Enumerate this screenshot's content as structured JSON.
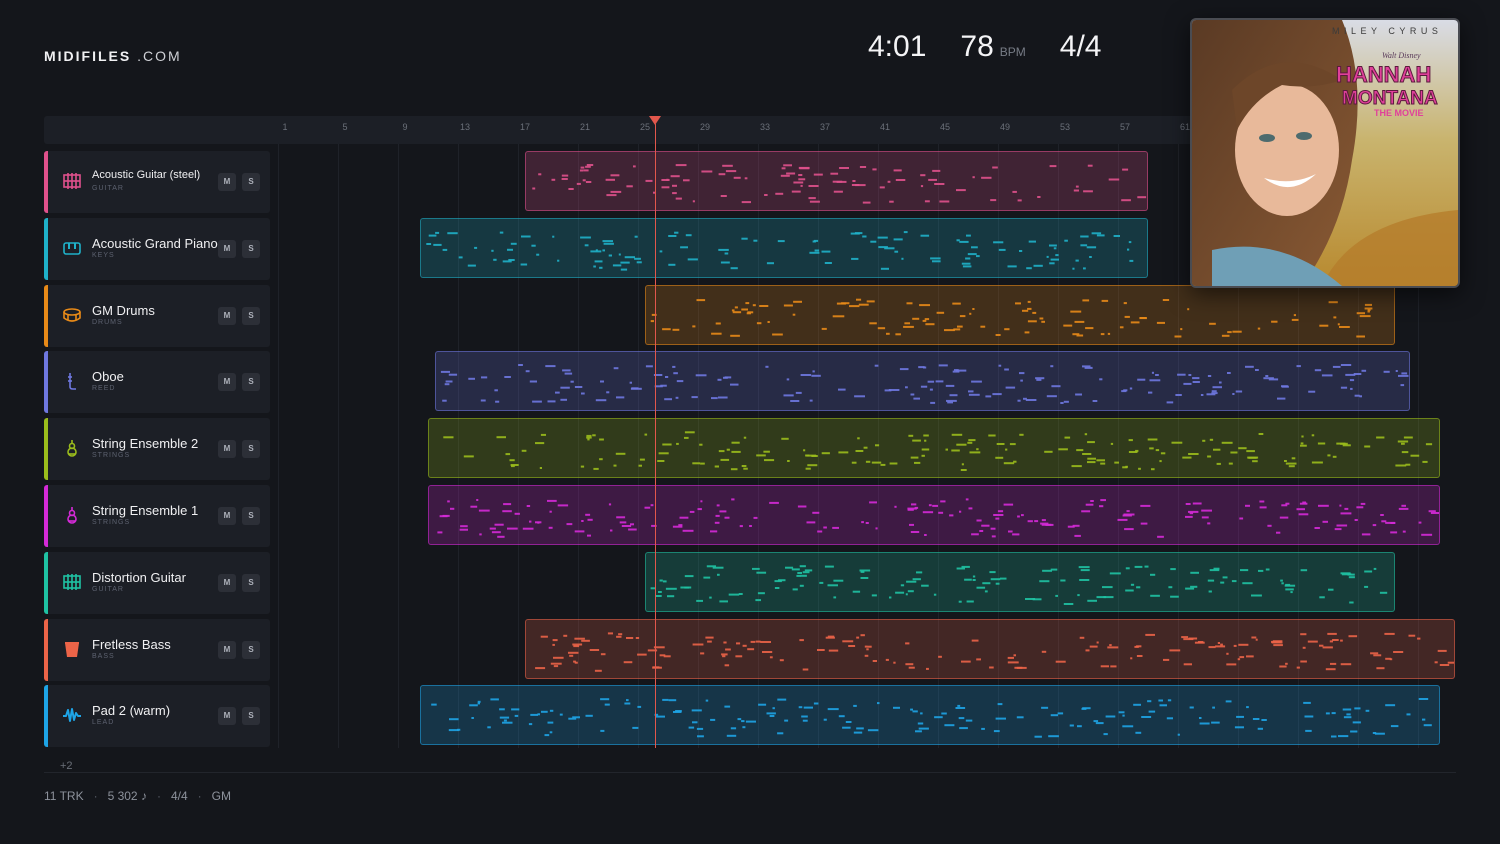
{
  "brand": {
    "bold": "MIDIFILES",
    "light": ".COM"
  },
  "header": {
    "duration": "4:01",
    "tempo": "78",
    "tempo_unit": "BPM",
    "time_signature": "4/4"
  },
  "cover": {
    "artist": "MILEY CYRUS",
    "presenter": "Walt Disney",
    "title_line1": "HANNAH",
    "title_line2": "MONTANA",
    "subtitle": "THE MOVIE"
  },
  "ruler": {
    "labels": [
      "1",
      "5",
      "9",
      "13",
      "17",
      "21",
      "25",
      "29",
      "33",
      "37",
      "41",
      "45",
      "49",
      "53",
      "57",
      "61"
    ]
  },
  "playhead": {
    "bar": 25
  },
  "tracks": [
    {
      "name": "Acoustic Guitar (steel)",
      "category": "GUITAR",
      "color": "#e0518c",
      "icon": "guitar-grid-icon",
      "mute": "M",
      "solo": "S",
      "clips": [
        {
          "start": 17,
          "end": 58.5
        }
      ]
    },
    {
      "name": "Acoustic Grand Piano",
      "category": "KEYS",
      "color": "#1fb1c9",
      "icon": "piano-icon",
      "mute": "M",
      "solo": "S",
      "clips": [
        {
          "start": 10,
          "end": 58.5
        }
      ]
    },
    {
      "name": "GM Drums",
      "category": "DRUMS",
      "color": "#e88a18",
      "icon": "drum-icon",
      "mute": "M",
      "solo": "S",
      "clips": [
        {
          "start": 25,
          "end": 75
        }
      ]
    },
    {
      "name": "Oboe",
      "category": "REED",
      "color": "#6f78e0",
      "icon": "oboe-icon",
      "mute": "M",
      "solo": "S",
      "clips": [
        {
          "start": 11,
          "end": 76
        }
      ]
    },
    {
      "name": "String Ensemble 2",
      "category": "STRINGS",
      "color": "#9bbd1c",
      "icon": "violin-icon",
      "mute": "M",
      "solo": "S",
      "clips": [
        {
          "start": 10.5,
          "end": 78
        }
      ]
    },
    {
      "name": "String Ensemble 1",
      "category": "STRINGS",
      "color": "#d52ad8",
      "icon": "violin-icon",
      "mute": "M",
      "solo": "S",
      "clips": [
        {
          "start": 10.5,
          "end": 78
        }
      ]
    },
    {
      "name": "Distortion Guitar",
      "category": "GUITAR",
      "color": "#1fc2a3",
      "icon": "guitar-grid-icon",
      "mute": "M",
      "solo": "S",
      "clips": [
        {
          "start": 25,
          "end": 75
        }
      ]
    },
    {
      "name": "Fretless Bass",
      "category": "BASS",
      "color": "#ec6448",
      "icon": "bass-icon",
      "mute": "M",
      "solo": "S",
      "clips": [
        {
          "start": 17,
          "end": 79
        }
      ]
    },
    {
      "name": "Pad 2 (warm)",
      "category": "LEAD",
      "color": "#1ea4e6",
      "icon": "wave-icon",
      "mute": "M",
      "solo": "S",
      "clips": [
        {
          "start": 10,
          "end": 78
        }
      ]
    }
  ],
  "more_tracks": "+2",
  "footer": {
    "tracks": "11 TRK",
    "notes": "5 302 ♪",
    "time_signature": "4/4",
    "standard": "GM"
  }
}
